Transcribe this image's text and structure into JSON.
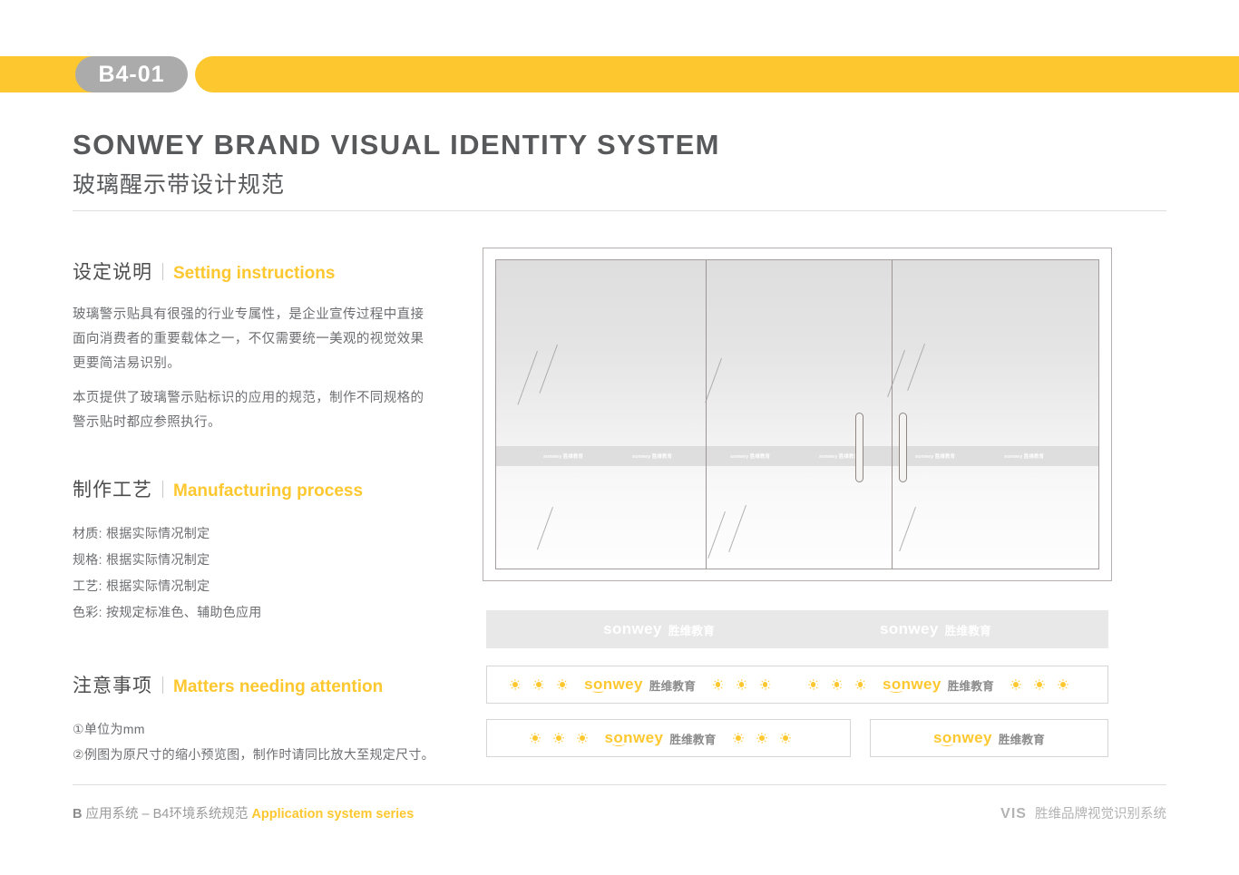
{
  "header": {
    "badge_label": "B4-01",
    "bar_color": "#FDC82F",
    "badge_color": "#ABABAB"
  },
  "title": {
    "english": "SONWEY BRAND VISUAL IDENTITY SYSTEM",
    "chinese": "玻璃醒示带设计规范"
  },
  "sections": [
    {
      "cn": "设定说明",
      "en": "Setting instructions",
      "paragraphs": [
        "玻璃警示贴具有很强的行业专属性，是企业宣传过程中直接面向消费者的重要载体之一，不仅需要统一美观的视觉效果更要简洁易识别。",
        "本页提供了玻璃警示贴标识的应用的规范，制作不同规格的警示贴时都应参照执行。"
      ]
    },
    {
      "cn": "制作工艺",
      "en": "Manufacturing process",
      "lines": [
        "材质: 根据实际情况制定",
        "规格: 根据实际情况制定",
        "工艺: 根据实际情况制定",
        "色彩: 按规定标准色、辅助色应用"
      ]
    },
    {
      "cn": "注意事项",
      "en": "Matters needing attention",
      "lines": [
        "①单位为mm",
        "②例图为原尺寸的缩小预览图，制作时请同比放大至规定尺寸。"
      ]
    }
  ],
  "logo": {
    "word": "sonwey",
    "chinese": "胜维教育",
    "word_color": "#FDC82F",
    "chinese_color": "#8A8A8A",
    "white_variant_color": "#FFFFFF"
  },
  "door": {
    "panel_count": 3,
    "band_logo_text": "sonwey 胜维教育",
    "band_logo_count": 6,
    "handle_count": 2
  },
  "strips": [
    {
      "id": "strip-gray-band",
      "style": "gray",
      "logo_count": 2,
      "suns": false
    },
    {
      "id": "strip-wide-suns",
      "style": "white",
      "logo_count": 2,
      "suns": true
    },
    {
      "id": "strip-narrow-suns",
      "style": "white",
      "logo_count": 1,
      "suns": true
    },
    {
      "id": "strip-logo-only",
      "style": "white",
      "logo_count": 1,
      "suns": false
    }
  ],
  "footer": {
    "left_prefix": "B",
    "left_chinese": "应用系统 – B4环境系统规范",
    "left_english": "Application system series",
    "right_vis": "VIS",
    "right_chinese": "胜维品牌视觉识别系统"
  }
}
